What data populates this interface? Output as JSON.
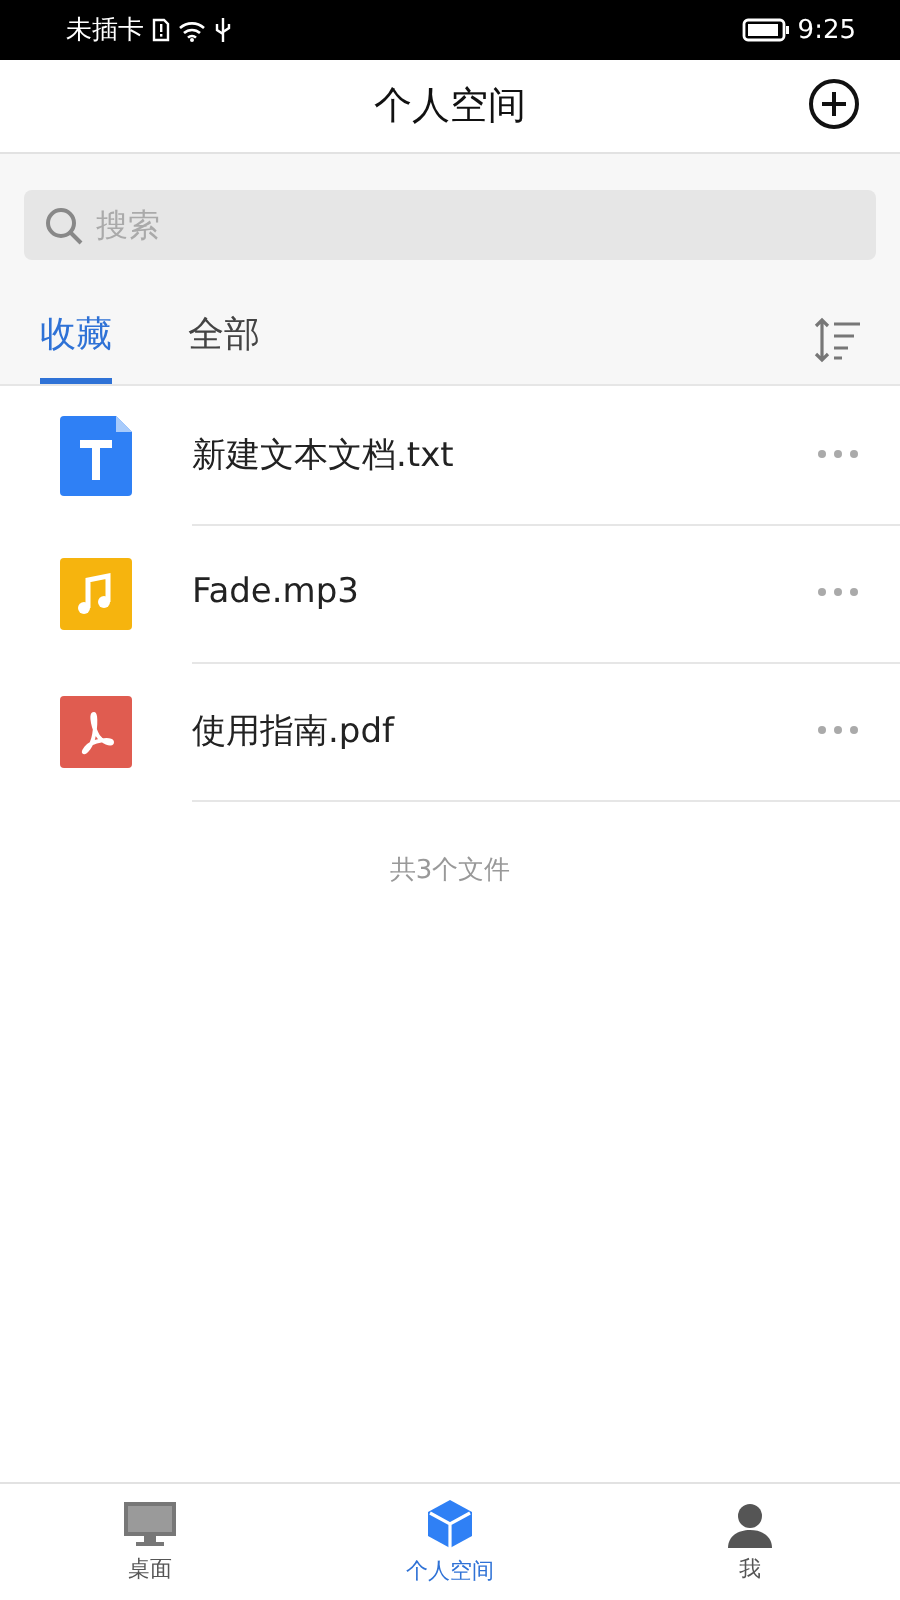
{
  "status_bar": {
    "carrier": "未插卡",
    "time": "9:25"
  },
  "header": {
    "title": "个人空间"
  },
  "search": {
    "placeholder": "搜索"
  },
  "tabs": [
    {
      "label": "收藏",
      "selected": true
    },
    {
      "label": "全部",
      "selected": false
    }
  ],
  "files": [
    {
      "name": "新建文本文档.txt",
      "kind": "text"
    },
    {
      "name": "Fade.mp3",
      "kind": "audio"
    },
    {
      "name": "使用指南.pdf",
      "kind": "pdf"
    }
  ],
  "file_count": "共3个文件",
  "bottom_nav": [
    {
      "label": "桌面",
      "kind": "desktop",
      "selected": false
    },
    {
      "label": "个人空间",
      "kind": "space",
      "selected": true
    },
    {
      "label": "我",
      "kind": "me",
      "selected": false
    }
  ]
}
